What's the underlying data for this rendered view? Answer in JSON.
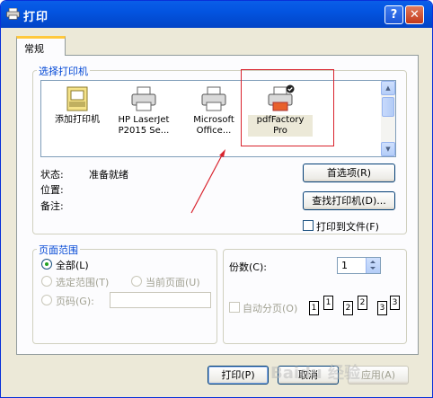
{
  "window": {
    "title": "打印",
    "help_label": "?",
    "close_label": "✕",
    "icon": "printer-icon"
  },
  "tabs": [
    {
      "label": "常规",
      "active": true
    }
  ],
  "select_printer": {
    "legend": "选择打印机",
    "printers": [
      {
        "label": "添加打印机",
        "icon": "add-printer-icon"
      },
      {
        "label": "HP LaserJet\nP2015 Se...",
        "icon": "printer-icon"
      },
      {
        "label": "Microsoft\nOffice...",
        "icon": "printer-icon"
      },
      {
        "label": "pdfFactory\nPro",
        "icon": "default-printer-icon",
        "selected": true
      }
    ],
    "status_label": "状态:",
    "status_value": "准备就绪",
    "location_label": "位置:",
    "location_value": "",
    "comment_label": "备注:",
    "comment_value": "",
    "preferences_button": "首选项(R)",
    "find_printer_button": "查找打印机(D)...",
    "print_to_file_label": "打印到文件(F)",
    "print_to_file_checked": false
  },
  "page_range": {
    "legend": "页面范围",
    "all_label": "全部(L)",
    "selection_label": "选定范围(T)",
    "current_page_label": "当前页面(U)",
    "pages_label": "页码(G):",
    "pages_value": "",
    "selected": "all"
  },
  "copies": {
    "label": "份数(C):",
    "value": "1",
    "collate_label": "自动分页(O)",
    "collate_checked": false,
    "collate_pages": [
      "1",
      "1",
      "2",
      "2",
      "3",
      "3"
    ]
  },
  "buttons": {
    "print": "打印(P)",
    "cancel": "取消",
    "apply": "应用(A)"
  },
  "colors": {
    "title_bar": "#0354e0",
    "legend_text": "#0046d5",
    "annotation_red": "#d9232d"
  },
  "watermark": "Baidu 经验"
}
